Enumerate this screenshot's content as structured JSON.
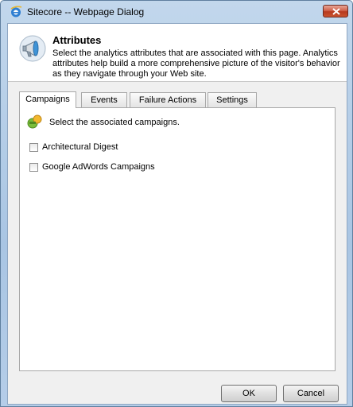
{
  "window": {
    "title": "Sitecore -- Webpage Dialog",
    "icon": "ie-icon",
    "close_icon": "close-icon"
  },
  "header": {
    "icon": "megaphone-icon",
    "title": "Attributes",
    "description": "Select the analytics attributes that are associated with this page. Analytics attributes help build a more comprehensive picture of the visitor's behavior as they navigate through your Web site."
  },
  "tabs": [
    {
      "label": "Campaigns",
      "active": true
    },
    {
      "label": "Events",
      "active": false
    },
    {
      "label": "Failure Actions",
      "active": false
    },
    {
      "label": "Settings",
      "active": false
    }
  ],
  "campaigns": {
    "icon": "campaigns-icon",
    "intro": "Select the associated campaigns.",
    "items": [
      {
        "label": "Architectural Digest",
        "checked": false
      },
      {
        "label": "Google AdWords Campaigns",
        "checked": false
      }
    ]
  },
  "buttons": {
    "ok": "OK",
    "cancel": "Cancel"
  },
  "colors": {
    "frame": "#b5cde8",
    "close_button": "#c9532f",
    "panel_background": "#ffffff"
  }
}
